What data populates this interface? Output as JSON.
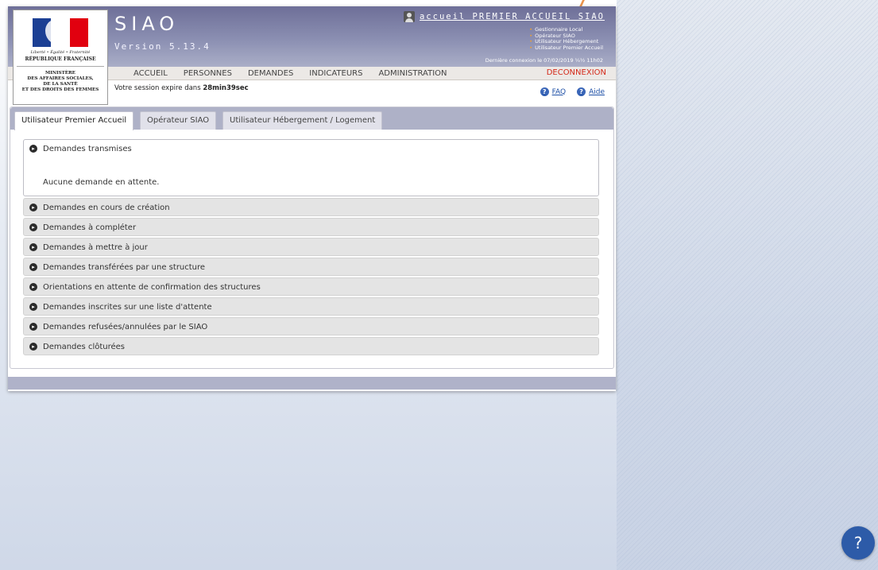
{
  "app": {
    "title": "SIAO",
    "version": "Version 5.13.4"
  },
  "logo": {
    "devise": "Liberté • Égalité • Fraternité",
    "republique": "RÉPUBLIQUE FRANÇAISE",
    "ministere_lines": [
      "MINISTÈRE",
      "DES AFFAIRES SOCIALES,",
      "DE LA SANTÉ",
      "ET DES DROITS DES FEMMES"
    ]
  },
  "user": {
    "name": "accueil PREMIER ACCUEIL SIAO",
    "icon": "user-icon",
    "roles": [
      "Gestionnaire Local",
      "Opérateur SIAO",
      "Utilisateur Hébergement",
      "Utilisateur Premier Accueil"
    ],
    "last_login": "Dernière connexion le 07/02/2019 ¼½ 11h02"
  },
  "menu": {
    "items": [
      "ACCUEIL",
      "PERSONNES",
      "DEMANDES",
      "INDICATEURS",
      "ADMINISTRATION"
    ],
    "logout": "DECONNEXION"
  },
  "session": {
    "prefix": "Votre session expire dans",
    "remaining": "28min39sec"
  },
  "help": {
    "faq": "FAQ",
    "aide": "Aide",
    "icon": "help-circle-icon"
  },
  "tabs": [
    {
      "label": "Utilisateur Premier Accueil",
      "active": true
    },
    {
      "label": "Opérateur SIAO",
      "active": false
    },
    {
      "label": "Utilisateur Hébergement / Logement",
      "active": false
    }
  ],
  "sections": {
    "open": {
      "title": "Demandes transmises",
      "message": "Aucune demande en attente."
    },
    "closed": [
      "Demandes en cours de création",
      "Demandes à compléter",
      "Demandes à mettre à jour",
      "Demandes transférées par une structure",
      "Orientations en attente de confirmation des structures",
      "Demandes inscrites sur une liste d'attente",
      "Demandes refusées/annulées par le SIAO",
      "Demandes clôturées"
    ]
  },
  "floating_help": {
    "label": "?"
  },
  "colors": {
    "header": "#8b8fb2",
    "menu_bar": "#ece9e6",
    "logout": "#d42a1a",
    "link": "#1d4fa6",
    "fab": "#2d5ba8"
  }
}
